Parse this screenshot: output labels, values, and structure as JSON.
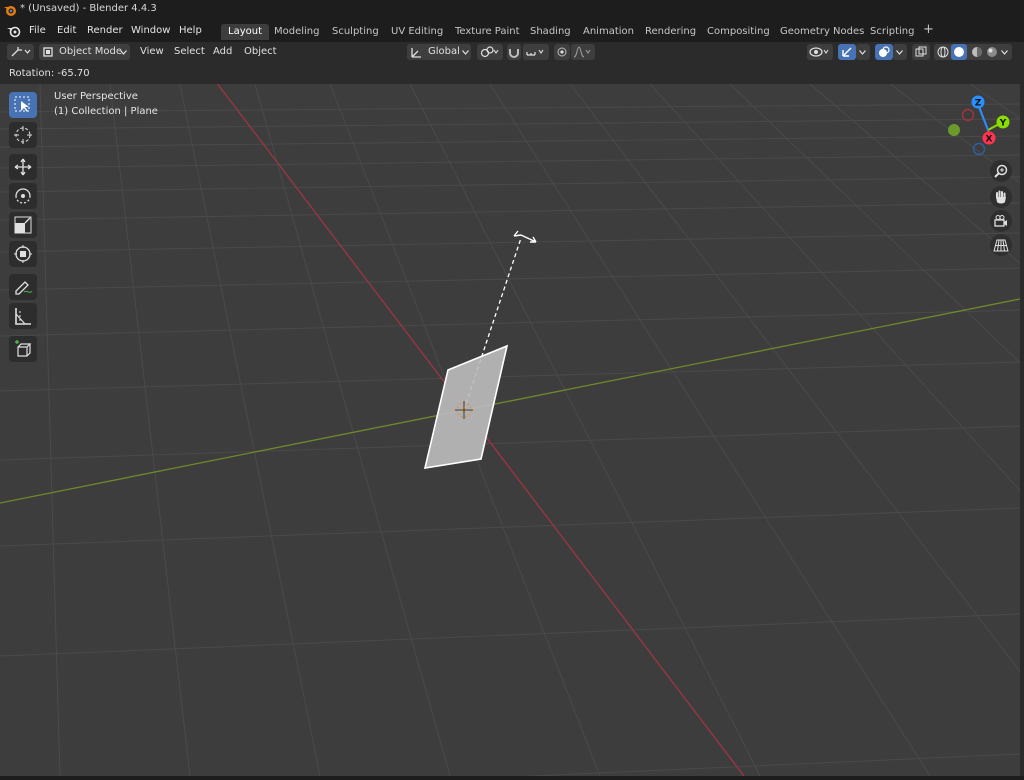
{
  "window": {
    "title": "* (Unsaved) - Blender 4.4.3"
  },
  "menu": {
    "file": "File",
    "edit": "Edit",
    "render": "Render",
    "window": "Window",
    "help": "Help"
  },
  "workspaces": [
    "Layout",
    "Modeling",
    "Sculpting",
    "UV Editing",
    "Texture Paint",
    "Shading",
    "Animation",
    "Rendering",
    "Compositing",
    "Geometry Nodes",
    "Scripting"
  ],
  "header": {
    "mode": "Object Mode",
    "view": "View",
    "select": "Select",
    "add": "Add",
    "object": "Object",
    "orientation": "Global"
  },
  "status": {
    "rotation": "Rotation: -65.70"
  },
  "viewport": {
    "perspective": "User Perspective",
    "collection": "(1) Collection | Plane"
  },
  "gizmo": {
    "z": "Z",
    "y": "Y",
    "x": "X"
  },
  "colors": {
    "accent": "#4772b3",
    "x_axis": "#ff3352",
    "y_axis": "#8bdc00",
    "z_axis": "#2890ff"
  }
}
